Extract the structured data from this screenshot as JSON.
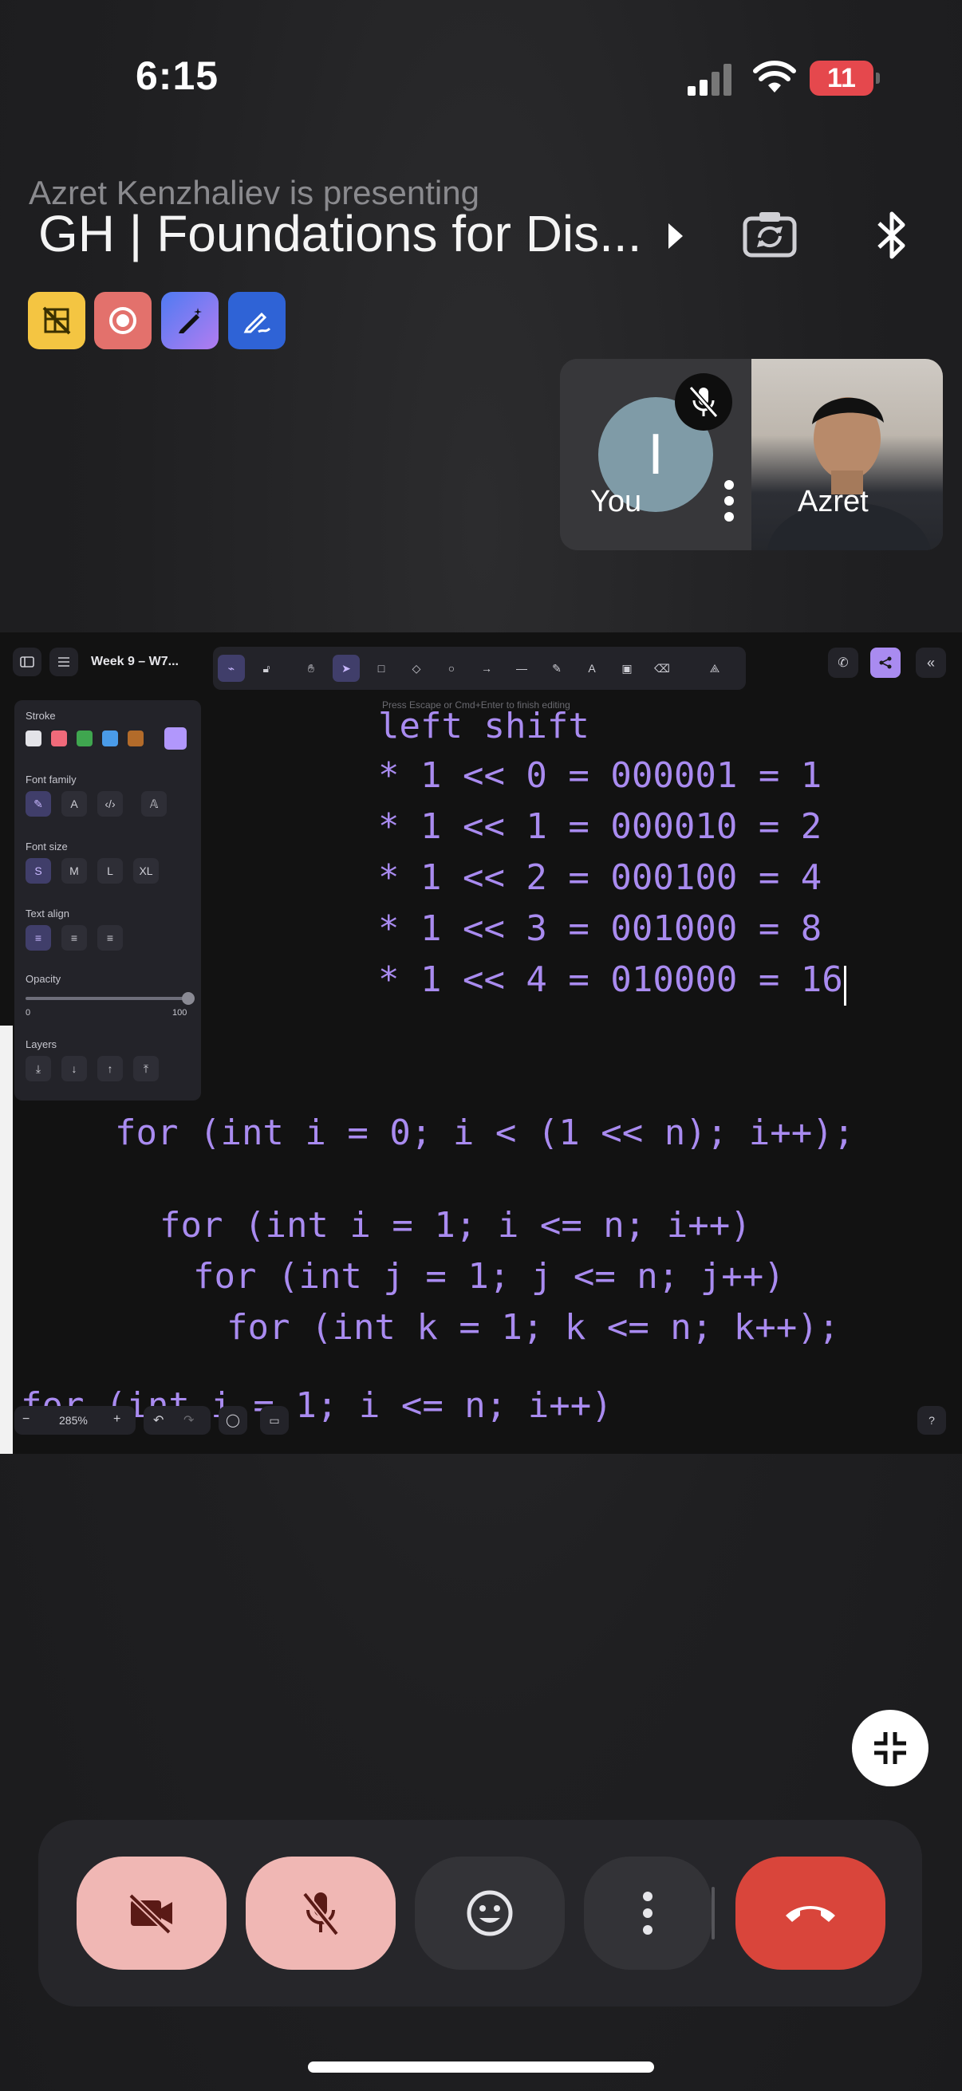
{
  "status_bar": {
    "time": "6:15",
    "battery": "11"
  },
  "meet": {
    "presenter_line": "Azret Kenzhaliev is presenting",
    "title": "GH | Foundations for Dis...",
    "participants": {
      "you_initial": "I",
      "you_label": "You",
      "azret_label": "Azret"
    }
  },
  "whiteboard": {
    "doc_name": "Week 9 – W7...",
    "hint": "Press Escape or Cmd+Enter to finish editing",
    "zoom": "285%",
    "panel": {
      "stroke": "Stroke",
      "stroke_colors": [
        "#e3e3e8",
        "#f06a7a",
        "#3fa64f",
        "#4a9be8",
        "#b36b2a",
        "#b197fc"
      ],
      "font_family": "Font family",
      "font_size": "Font size",
      "sizes": [
        "S",
        "M",
        "L",
        "XL"
      ],
      "text_align": "Text align",
      "opacity": "Opacity",
      "opacity_min": "0",
      "opacity_max": "100",
      "opacity_value": 100,
      "layers": "Layers"
    },
    "lines": [
      "left shift",
      "* 1 << 0 = 000001 = 1",
      "* 1 << 1 = 000010 = 2",
      "* 1 << 2 = 000100 = 4",
      "* 1 << 3 = 001000 = 8",
      "* 1 << 4 = 010000 = 16"
    ],
    "code_lines": [
      "for (int i = 0; i < (1 << n); i++);",
      "for (int i = 1; i <= n; i++)",
      "for (int j = 1; j <= n; j++)",
      "for (int k = 1; k <= n; k++);",
      "for (int i = 1; i <= n; i++)"
    ]
  },
  "colors": {
    "accent": "#a98bf0",
    "end_call": "#d9453b",
    "muted_btn": "#f0b7b4"
  }
}
